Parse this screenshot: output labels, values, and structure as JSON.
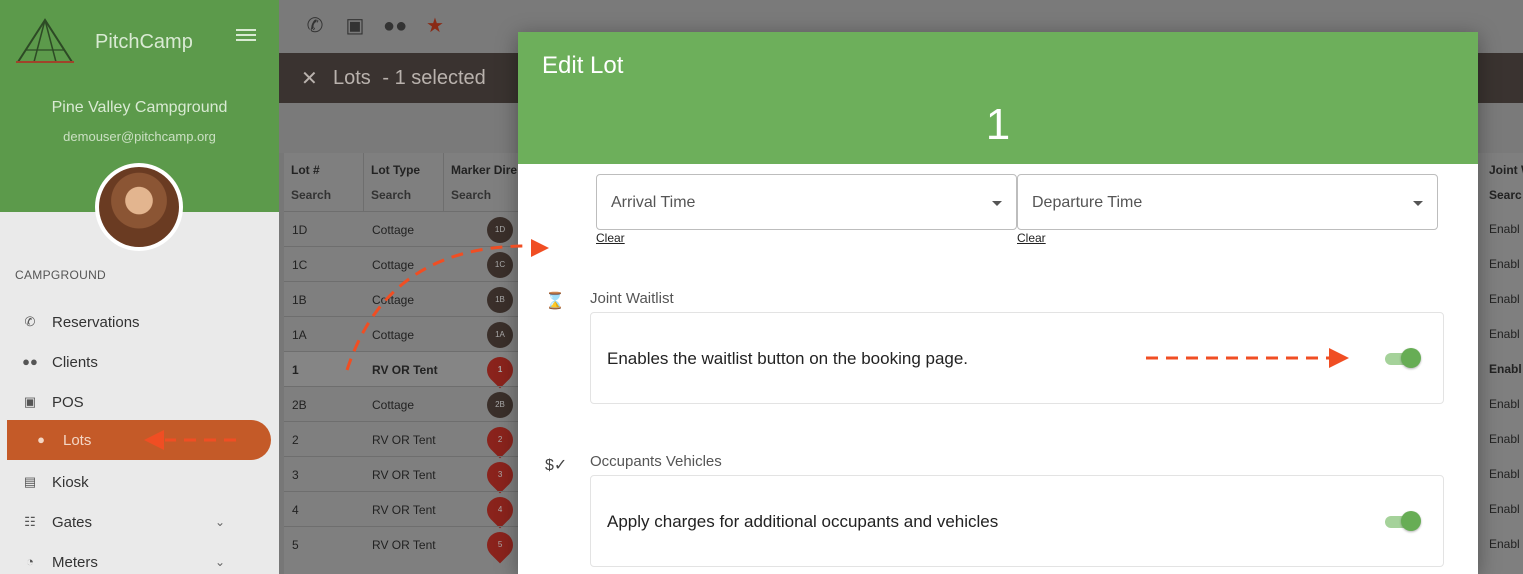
{
  "app": {
    "name": "PitchCamp"
  },
  "sidebar": {
    "campground_name": "Pine Valley Campground",
    "user_email": "demouser@pitchcamp.org",
    "section_title": "CAMPGROUND",
    "items": [
      {
        "label": "Reservations",
        "icon": "phone-icon"
      },
      {
        "label": "Clients",
        "icon": "people-icon"
      },
      {
        "label": "POS",
        "icon": "store-icon"
      },
      {
        "label": "Lots",
        "icon": "location-pin-icon",
        "active": true
      },
      {
        "label": "Kiosk",
        "icon": "kiosk-icon"
      },
      {
        "label": "Gates",
        "icon": "gate-icon",
        "expandable": true
      },
      {
        "label": "Meters",
        "icon": "meter-icon",
        "expandable": true
      }
    ]
  },
  "topbar": {
    "icons": [
      "phone-icon",
      "store-icon",
      "people-icon",
      "star-icon"
    ]
  },
  "selection_bar": {
    "title": "Lots",
    "selected_text": "- 1 selected"
  },
  "table": {
    "columns": [
      {
        "header": "Lot #",
        "filter": "Search"
      },
      {
        "header": "Lot Type",
        "filter": "Search"
      },
      {
        "header": "Marker Dire",
        "filter": "Search"
      }
    ],
    "rows": [
      {
        "lot": "1D",
        "type": "Cottage",
        "marker": "1D",
        "marker_style": "dark"
      },
      {
        "lot": "1C",
        "type": "Cottage",
        "marker": "1C",
        "marker_style": "dark"
      },
      {
        "lot": "1B",
        "type": "Cottage",
        "marker": "1B",
        "marker_style": "dark"
      },
      {
        "lot": "1A",
        "type": "Cottage",
        "marker": "1A",
        "marker_style": "dark"
      },
      {
        "lot": "1",
        "type": "RV OR Tent",
        "marker": "1",
        "marker_style": "red",
        "selected": true
      },
      {
        "lot": "2B",
        "type": "Cottage",
        "marker": "2B",
        "marker_style": "dark"
      },
      {
        "lot": "2",
        "type": "RV OR Tent",
        "marker": "2",
        "marker_style": "red"
      },
      {
        "lot": "3",
        "type": "RV OR Tent",
        "marker": "3",
        "marker_style": "red"
      },
      {
        "lot": "4",
        "type": "RV OR Tent",
        "marker": "4",
        "marker_style": "red"
      },
      {
        "lot": "5",
        "type": "RV OR Tent",
        "marker": "5",
        "marker_style": "red"
      }
    ],
    "right_column": {
      "header": "Joint W",
      "filter": "Searc",
      "values": [
        "Enabl",
        "Enabl",
        "Enabl",
        "Enabl",
        "Enabl",
        "Enabl",
        "Enabl",
        "Enabl",
        "Enabl",
        "Enabl"
      ]
    }
  },
  "modal": {
    "title": "Edit Lot",
    "subtitle": "1",
    "arrival_placeholder": "Arrival Time",
    "departure_placeholder": "Departure Time",
    "clear_label": "Clear",
    "sections": [
      {
        "label": "Joint Waitlist",
        "icon": "hourglass-icon",
        "description": "Enables the waitlist button on the booking page.",
        "enabled": true
      },
      {
        "label": "Occupants Vehicles",
        "icon": "dollar-check-icon",
        "description": "Apply charges for additional occupants and vehicles",
        "enabled": true
      }
    ]
  },
  "colors": {
    "accent_green": "#6daf5b",
    "active_nav": "#c45a28",
    "annotation_arrow": "#f04e23"
  }
}
